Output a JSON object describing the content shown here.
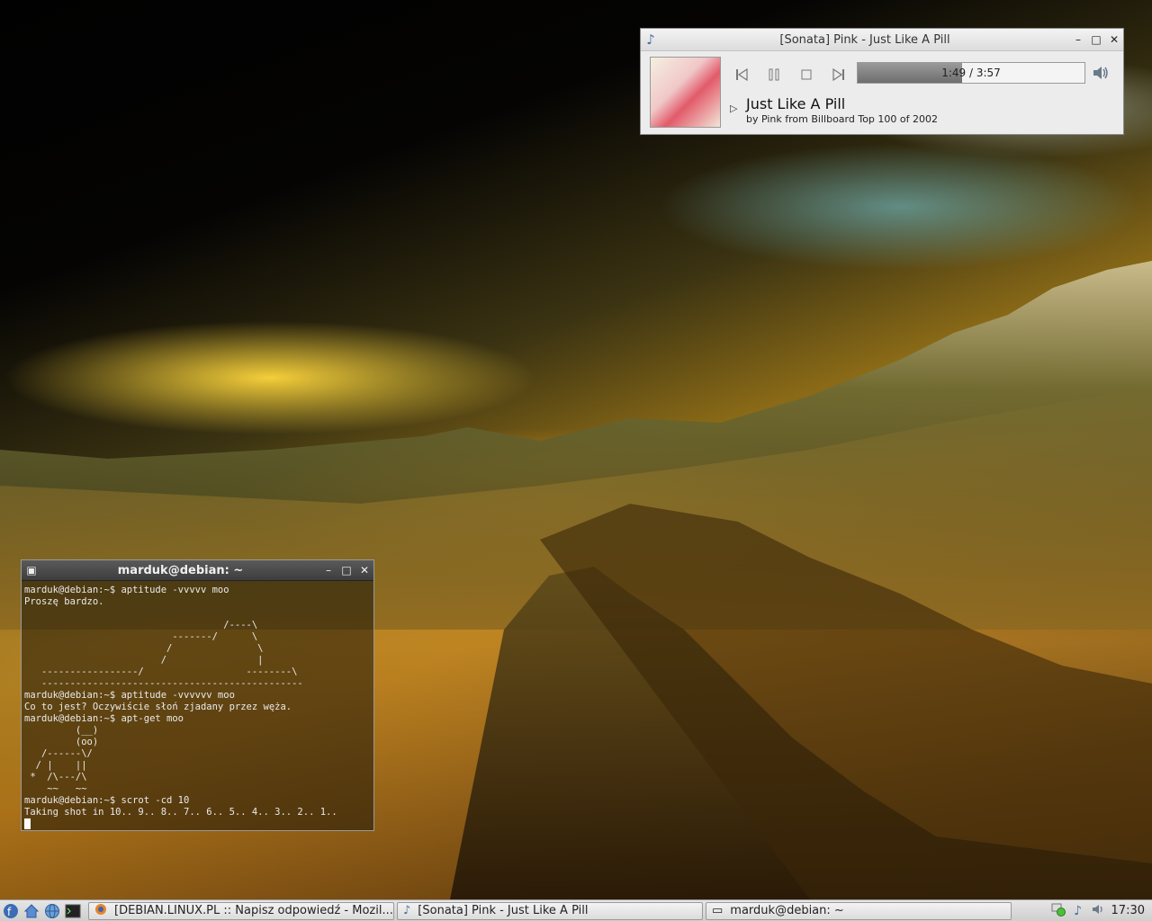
{
  "colors": {
    "accent": "#4a6fa8",
    "titlebar_light": "#e8e8e8",
    "titlebar_dark": "#484848",
    "taskbar": "#dadada"
  },
  "sonata": {
    "title": "[Sonata] Pink - Just Like A Pill",
    "icon": "music-note-icon",
    "minimize_label": "–",
    "maximize_label": "□",
    "close_label": "✕",
    "progress": {
      "elapsed": "1:49",
      "total": "3:57",
      "text": "1:49 / 3:57",
      "fraction": 0.46
    },
    "track": {
      "title": "Just Like A Pill",
      "subtitle": "by Pink from Billboard Top 100 of 2002"
    },
    "controls": [
      "previous-icon",
      "pause-icon",
      "stop-icon",
      "next-icon",
      "volume-icon"
    ]
  },
  "terminal": {
    "title": "marduk@debian: ~",
    "minimize_label": "–",
    "maximize_label": "□",
    "close_label": "✕",
    "lines": [
      "marduk@debian:~$ aptitude -vvvvv moo",
      "Proszę bardzo.",
      "",
      "                                   /----\\",
      "                          -------/      \\",
      "                         /               \\",
      "                        /                |",
      "   -----------------/                  --------\\",
      "   ----------------------------------------------",
      "marduk@debian:~$ aptitude -vvvvvv moo",
      "Co to jest? Oczywiście słoń zjadany przez węża.",
      "marduk@debian:~$ apt-get moo",
      "         (__)",
      "         (oo)",
      "   /------\\/",
      "  / |    ||",
      " *  /\\---/\\",
      "    ~~   ~~",
      "marduk@debian:~$ scrot -cd 10",
      "Taking shot in 10.. 9.. 8.. 7.. 6.. 5.. 4.. 3.. 2.. 1.."
    ]
  },
  "taskbar": {
    "launchers": [
      "menu-icon",
      "home-icon",
      "browser-icon",
      "terminal-icon"
    ],
    "tasks": [
      {
        "label": "[DEBIAN.LINUX.PL :: Napisz odpowiedź - Mozil...",
        "icon": "firefox-icon"
      },
      {
        "label": "[Sonata] Pink - Just Like A Pill",
        "icon": "music-note-icon"
      },
      {
        "label": "marduk@debian: ~",
        "icon": "terminal-window-icon"
      }
    ],
    "tray": [
      "network-icon",
      "sonata-tray-icon",
      "volume-tray-icon"
    ],
    "clock": "17:30"
  }
}
